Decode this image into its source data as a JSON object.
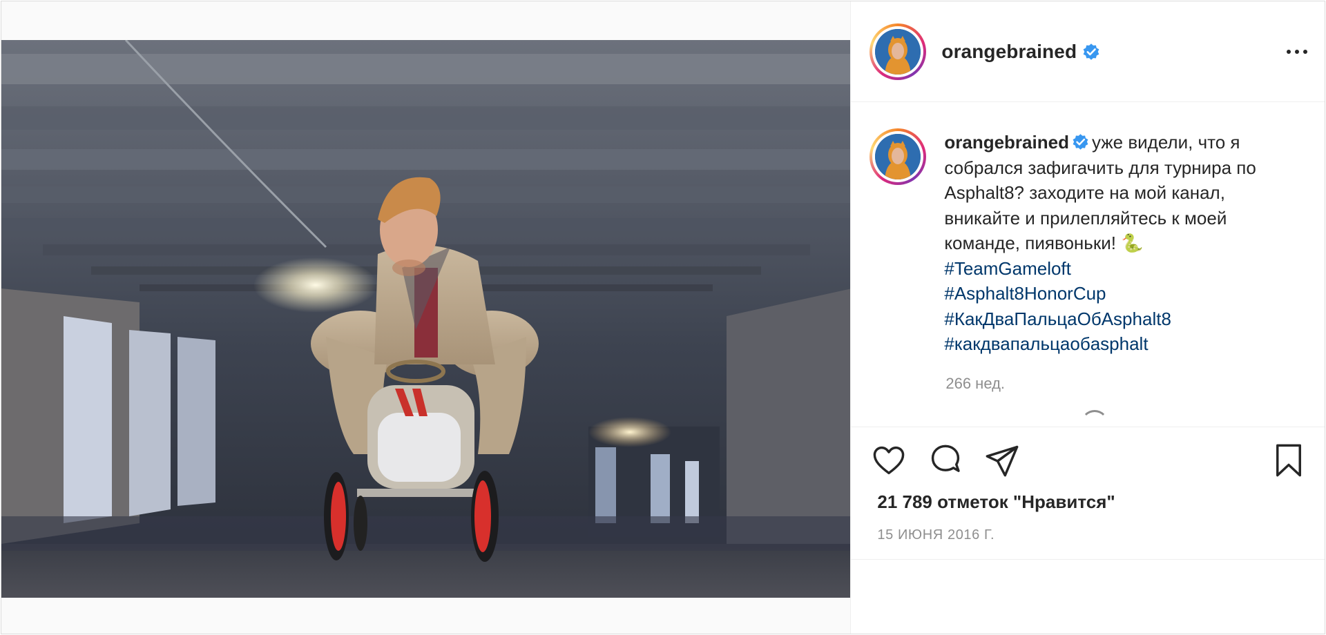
{
  "post": {
    "author": {
      "username": "orangebrained",
      "verified": true
    },
    "caption": {
      "username": "orangebrained",
      "text": "уже видели, что я собрался зафигачить для турнира по Asphalt8? заходите на мой канал, вникайте и прилепляйтесь к моей команде, пиявоньки! 🐍",
      "hashtags": [
        "#TeamGameloft",
        "#Asphalt8HonorCup",
        "#КакДваПальцаОбAsphalt8",
        "#какдвапальцаобasphalt"
      ],
      "time_ago": "266 нед."
    },
    "likes_text": "21 789 отметок \"Нравится\"",
    "date": "15 ИЮНЯ 2016 Г."
  },
  "icons": {
    "verified": "verified-badge-icon",
    "more": "more-options-icon",
    "like": "heart-icon",
    "comment": "comment-bubble-icon",
    "share": "paper-plane-icon",
    "save": "bookmark-icon"
  },
  "colors": {
    "hashtag": "#00376b",
    "verified": "#3897f0",
    "muted": "#8e8e8e",
    "text": "#262626"
  }
}
